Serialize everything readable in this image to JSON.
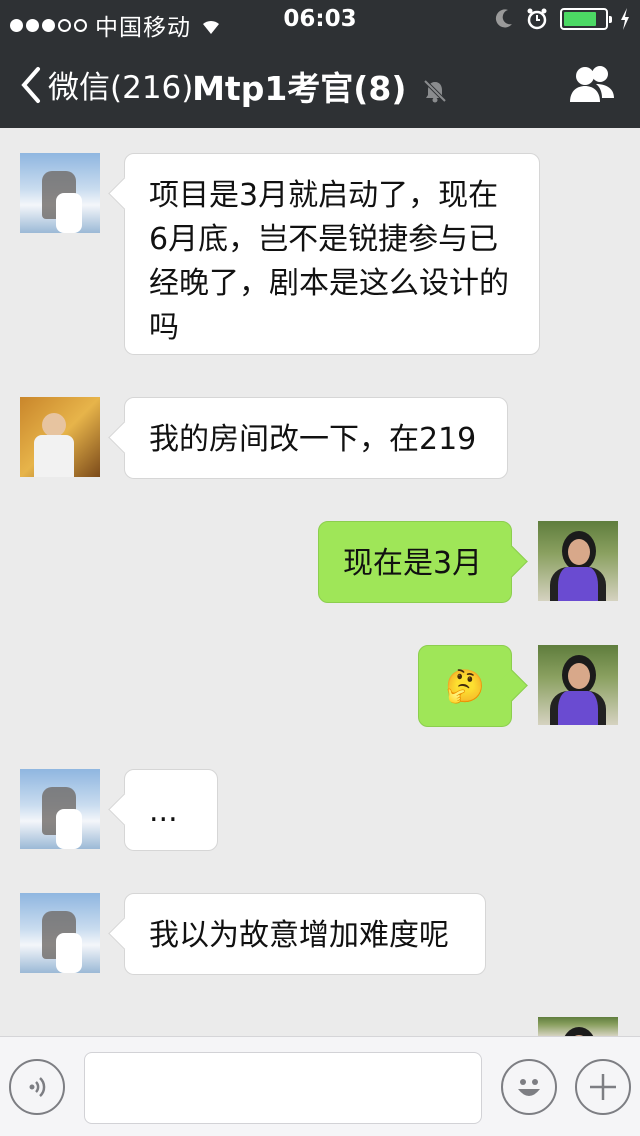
{
  "status_bar": {
    "carrier": "中国移动",
    "time": "06:03",
    "signal_bars_filled": 3,
    "signal_bars_total": 5,
    "battery_level": 0.8
  },
  "nav": {
    "back_label": "微信(216)",
    "title": "Mtp1考官(8)",
    "title_muted": true,
    "right_icon": "group-members-icon"
  },
  "messages": [
    {
      "side": "in",
      "avatar": "sky-photo",
      "text": "项目是3月就启动了，现在6月底，岂不是锐捷参与已经晚了，剧本是这么设计的吗"
    },
    {
      "side": "in",
      "avatar": "room-photo",
      "text": "我的房间改一下，在219"
    },
    {
      "side": "out",
      "avatar": "woman-photo",
      "text": "现在是3月"
    },
    {
      "side": "out",
      "avatar": "woman-photo",
      "text": "🤔",
      "is_emoji": true
    },
    {
      "side": "in",
      "avatar": "sky-photo",
      "text": "..."
    },
    {
      "side": "in",
      "avatar": "sky-photo",
      "text": "我以为故意增加难度呢"
    }
  ],
  "input_bar": {
    "voice_icon": "voice-icon",
    "text_value": "",
    "emoji_icon": "emoji-icon",
    "plus_icon": "plus-icon"
  },
  "colors": {
    "nav_bg": "#2e3134",
    "chat_bg": "#ebebeb",
    "outgoing_bubble": "#9fe658",
    "incoming_bubble": "#ffffff"
  }
}
